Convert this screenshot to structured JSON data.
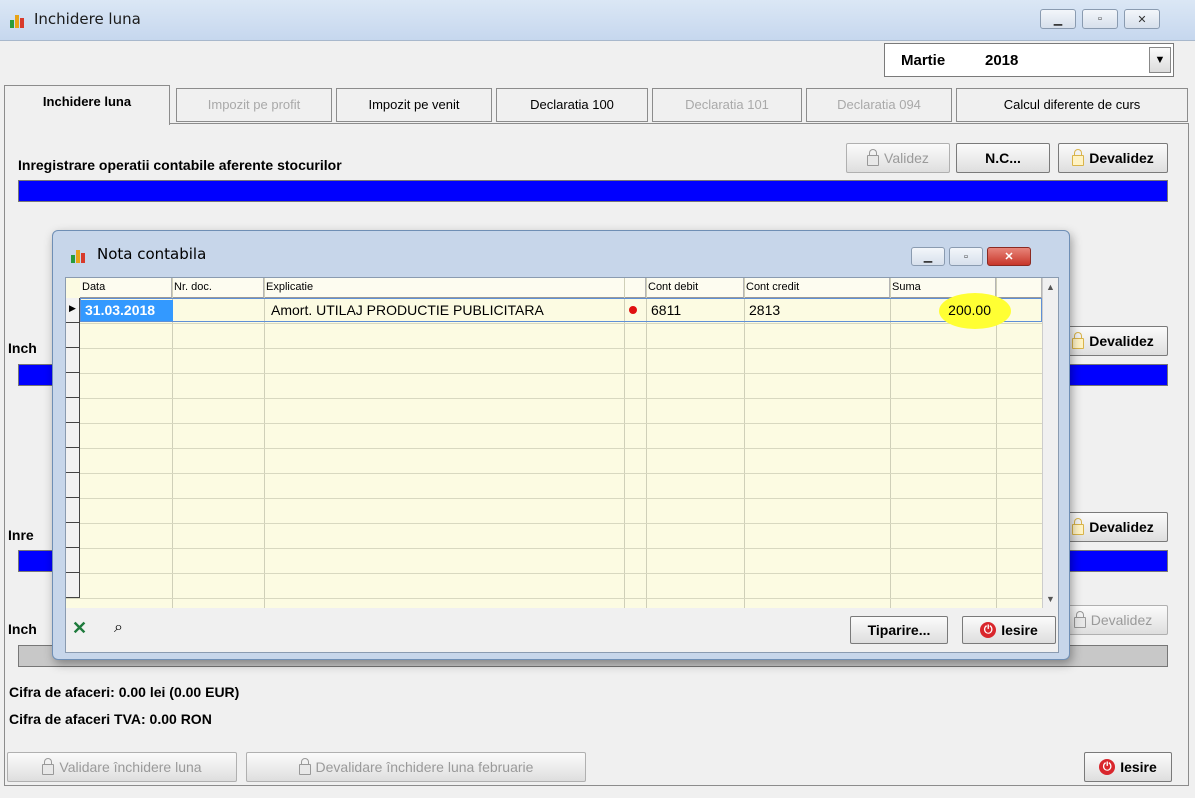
{
  "window": {
    "title": "Inchidere luna",
    "controls": [
      "minimize",
      "maximize",
      "close"
    ]
  },
  "period": {
    "month": "Martie",
    "year": "2018"
  },
  "tabs": [
    {
      "label": "Inchidere luna",
      "state": "selected"
    },
    {
      "label": "Impozit pe profit",
      "state": "disabled"
    },
    {
      "label": "Impozit pe venit",
      "state": "enabled"
    },
    {
      "label": "Declaratia 100",
      "state": "enabled"
    },
    {
      "label": "Declaratia 101",
      "state": "disabled"
    },
    {
      "label": "Declaratia 094",
      "state": "disabled"
    },
    {
      "label": "Calcul diferente de curs",
      "state": "enabled"
    }
  ],
  "section1": {
    "title": "Inregistrare operatii contabile aferente stocurilor",
    "validate_label": "Validez",
    "nc_label": "N.C...",
    "devalidate_label": "Devalidez"
  },
  "section2": {
    "title": "Inch",
    "devalidate_label": "Devalidez"
  },
  "section3": {
    "title": "Inre",
    "devalidate_label": "Devalidez"
  },
  "section4": {
    "title": "Inch",
    "devalidate_label": "Devalidez"
  },
  "info": {
    "cifra_afaceri": "Cifra de afaceri: 0.00 lei (0.00 EUR)",
    "cifra_afaceri_tva": "Cifra de afaceri TVA: 0.00 RON"
  },
  "footer": {
    "validate_close_label": "Validare închidere luna",
    "devalidate_close_label": "Devalidare închidere luna februarie",
    "exit_label": "Iesire"
  },
  "dialog": {
    "title": "Nota contabila",
    "columns": [
      "Data",
      "Nr. doc.",
      "Explicatie",
      "Cont debit",
      "Cont credit",
      "Suma"
    ],
    "rows": [
      {
        "data": "31.03.2018",
        "nr_doc": "",
        "explicatie": "Amort. UTILAJ PRODUCTIE PUBLICITARA",
        "cont_debit": "6811",
        "cont_credit": "2813",
        "suma": "200.00"
      }
    ],
    "print_label": "Tiparire...",
    "exit_label": "Iesire",
    "colors": {
      "highlight": "#ffff33",
      "selected_cell": "#3399ff",
      "grid_bg": "#fcfbe2"
    }
  }
}
